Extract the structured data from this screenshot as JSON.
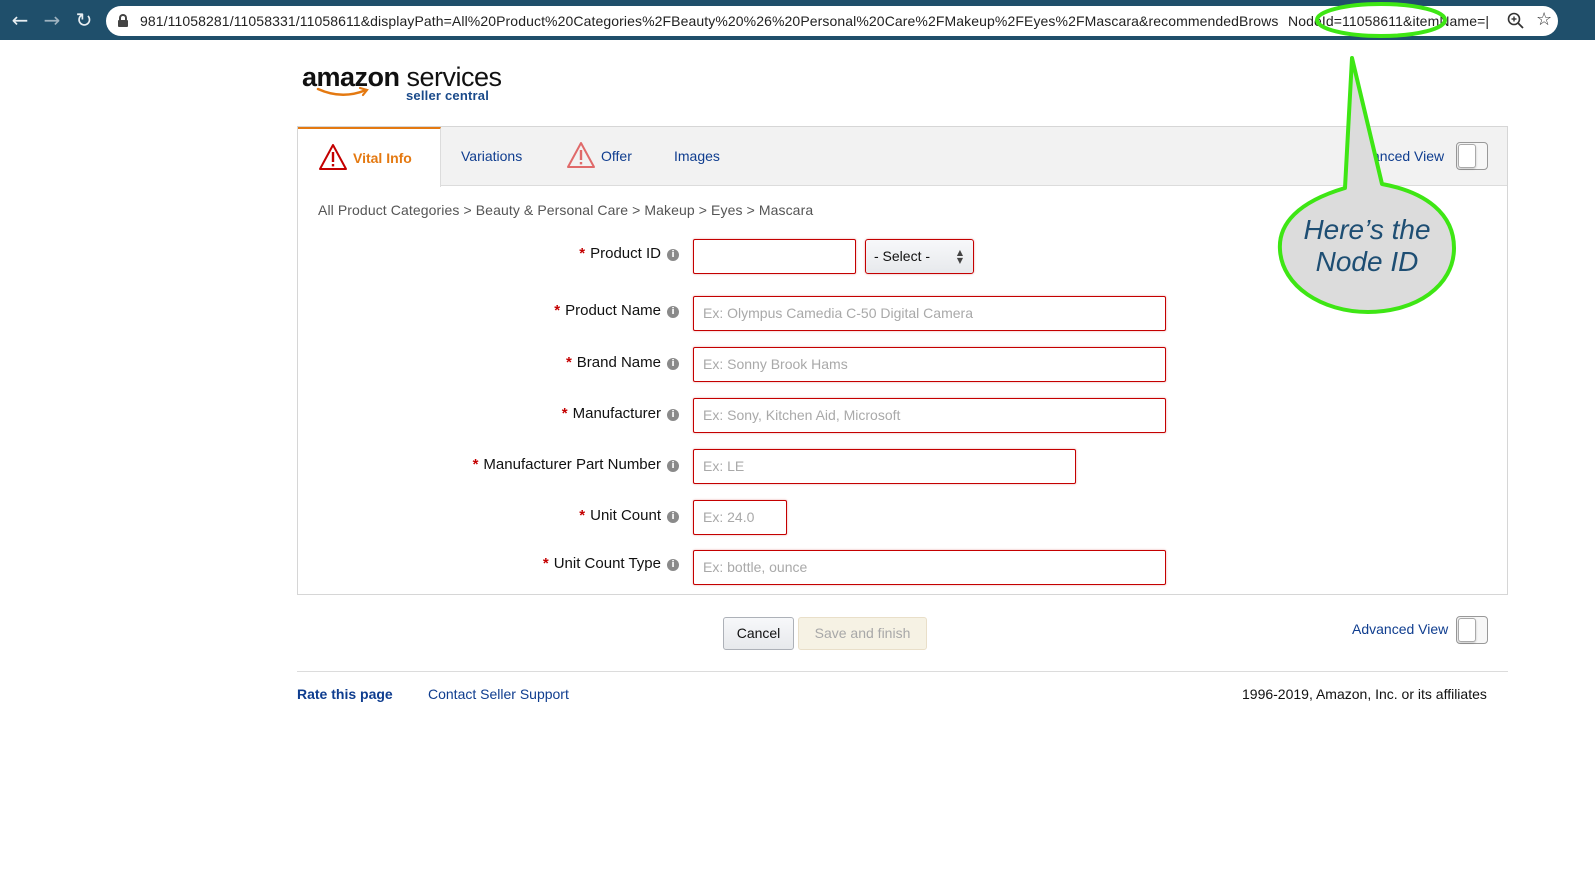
{
  "browser": {
    "url_part1": "981/11058281/11058331/11058611&displayPath=All%20Product%20Categories%2FBeauty%20%26%20Personal%20Care%2FMakeup%2FEyes%2FMascara&recommendedBrows",
    "url_highlight": "NodeId=11058611&",
    "url_part3": "itemName=|",
    "back_icon": "arrow-left-icon",
    "forward_icon": "arrow-right-icon",
    "reload_icon": "reload-icon",
    "zoom_icon": "magnifier-zoom-icon",
    "bookmark_icon": "star-icon"
  },
  "logo": {
    "word_a": "amazon",
    "word_b": " services",
    "sub": "seller central"
  },
  "tabs": [
    {
      "label": "Vital Info",
      "warning": true,
      "active": true
    },
    {
      "label": "Variations",
      "warning": false,
      "active": false
    },
    {
      "label": "Offer",
      "warning": true,
      "active": false
    },
    {
      "label": "Images",
      "warning": false,
      "active": false
    }
  ],
  "advanced_view_top": "anced View",
  "advanced_view_bottom": "Advanced View",
  "breadcrumb": "All Product Categories > Beauty & Personal Care > Makeup > Eyes > Mascara",
  "form": {
    "required_mark": "*",
    "info_glyph": "i",
    "fields": [
      {
        "label": "Product ID",
        "value": "",
        "placeholder": ""
      },
      {
        "label": "Product Name",
        "placeholder": "Ex: Olympus Camedia C-50 Digital Camera"
      },
      {
        "label": "Brand Name",
        "placeholder": "Ex: Sonny Brook Hams"
      },
      {
        "label": "Manufacturer",
        "placeholder": "Ex: Sony, Kitchen Aid, Microsoft"
      },
      {
        "label": "Manufacturer Part Number",
        "placeholder": "Ex: LE"
      },
      {
        "label": "Unit Count",
        "placeholder": "Ex: 24.0"
      },
      {
        "label": "Unit Count Type",
        "placeholder": "Ex: bottle, ounce"
      }
    ],
    "product_id_type_select": "- Select -"
  },
  "buttons": {
    "cancel": "Cancel",
    "save": "Save and finish"
  },
  "footer": {
    "rate": "Rate this page",
    "contact": "Contact Seller Support",
    "copyright": "1996-2019, Amazon, Inc. or its affiliates"
  },
  "annotation": {
    "line1": "Here’s the",
    "line2": "Node ID",
    "color_outline": "#3ee614",
    "color_fill": "#dcdcdc",
    "color_text": "#1e4e73"
  },
  "colors": {
    "chrome": "#1f4f6b",
    "accent_orange": "#e47911",
    "link_blue": "#0f3d8f",
    "error_red": "#c40000"
  }
}
